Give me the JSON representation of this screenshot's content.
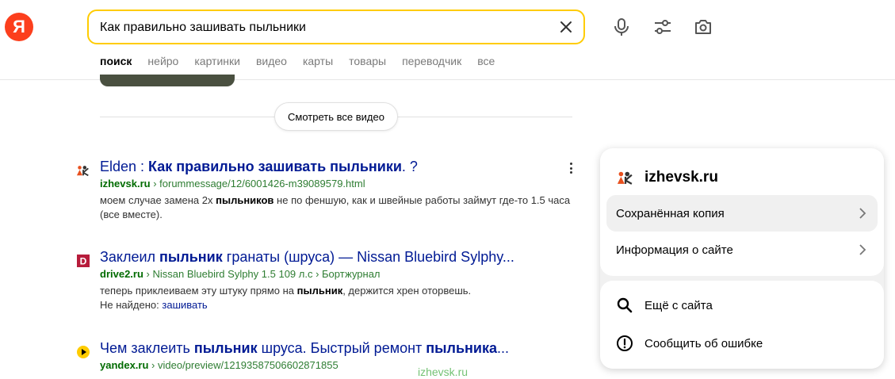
{
  "logo": {
    "letter": "Я"
  },
  "search": {
    "query": "Как правильно зашивать пыльники"
  },
  "nav": [
    "поиск",
    "нейро",
    "картинки",
    "видео",
    "карты",
    "товары",
    "переводчик",
    "все"
  ],
  "videos": {
    "see_all": "Смотреть все видео"
  },
  "results": [
    {
      "title_pre": "Elden : ",
      "title_bold": "Как правильно зашивать пыльники",
      "title_post": ". ?",
      "domain": "izhevsk.ru",
      "path": "› forummessage/12/6001426-m39089579.html",
      "snippet_pre": "моем случае замена 2х ",
      "snippet_bold": "пыльников",
      "snippet_post": " не по феншую, как и швейные работы займут где-то 1.5 часа (все вместе)."
    },
    {
      "title_pre": "Заклеил ",
      "title_bold": "пыльник",
      "title_post": " гранаты (шруса) — Nissan Bluebird Sylphy...",
      "domain": "drive2.ru",
      "path": "› Nissan Bluebird Sylphy 1.5 109 л.с › Бортжурнал",
      "snippet_pre": "теперь приклеиваем эту штуку прямо на ",
      "snippet_bold": "пыльник",
      "snippet_post": ", держится хрен оторвешь.",
      "not_found_label": "Не найдено:",
      "not_found_word": "зашивать"
    },
    {
      "title_pre": "Чем заклеить ",
      "title_bold": "пыльник",
      "title_mid": " шруса. Быстрый ремонт ",
      "title_bold2": "пыльника",
      "title_post": "...",
      "domain": "yandex.ru",
      "path": "› video/preview/12193587506602871855"
    }
  ],
  "watermark": "izhevsk.ru",
  "popup": {
    "site": "izhevsk.ru",
    "items": [
      "Сохранённая копия",
      "Информация о сайте"
    ],
    "more_from_site": "Ещё с сайта",
    "report_error": "Сообщить об ошибке"
  },
  "colors": {
    "accent": "#ffcc00",
    "logo": "#fc3f1d",
    "link": "#001a94",
    "url": "#006b00"
  }
}
